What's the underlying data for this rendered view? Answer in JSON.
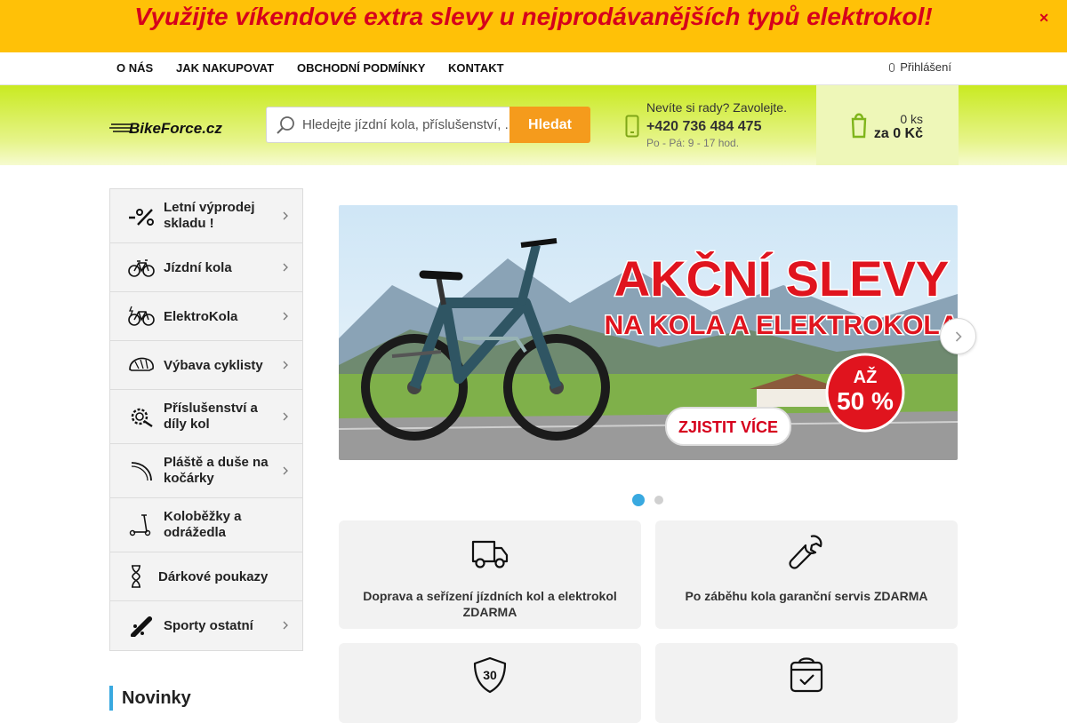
{
  "promo": {
    "text": "Využijte víkendové extra slevy u nejprodávanějších typů elektrokol!",
    "close_icon": "close-icon"
  },
  "topnav": {
    "items": [
      "O nás",
      "Jak nakupovat",
      "Obchodní podmínky",
      "Kontakt"
    ],
    "login_label": "Přihlášení"
  },
  "header": {
    "logo_text": "BikeForce.cz",
    "search_placeholder": "Hledejte jízdní kola, příslušenství, ...",
    "search_button": "Hledat",
    "help_title": "Nevíte si rady? Zavolejte.",
    "phone": "+420 736 484 475",
    "hours": "Po - Pá: 9 - 17 hod.",
    "cart_count": "0 ks",
    "cart_price": "za 0 Kč"
  },
  "sidebar": {
    "items": [
      {
        "label": "Letní výprodej skladu !",
        "icon": "percent-icon",
        "has_arrow": true
      },
      {
        "label": "Jízdní kola",
        "icon": "bicycle-icon",
        "has_arrow": true
      },
      {
        "label": "ElektroKola",
        "icon": "ebike-icon",
        "has_arrow": true
      },
      {
        "label": "Výbava cyklisty",
        "icon": "helmet-icon",
        "has_arrow": true
      },
      {
        "label": "Příslušenství a díly kol",
        "icon": "gear-icon",
        "has_arrow": true
      },
      {
        "label": "Pláště a duše na kočárky",
        "icon": "tire-icon",
        "has_arrow": true
      },
      {
        "label": "Koloběžky a odrážedla",
        "icon": "scooter-icon",
        "has_arrow": false
      },
      {
        "label": "Dárkové poukazy",
        "icon": "hourglass-icon",
        "has_arrow": false
      },
      {
        "label": "Sporty ostatní",
        "icon": "skateboard-icon",
        "has_arrow": true
      }
    ],
    "novinky": "Novinky"
  },
  "banner": {
    "line1": "AKČNÍ SLEVY",
    "line2": "NA KOLA A ELEKTROKOLA",
    "badge_top": "AŽ",
    "badge_value": "50 %",
    "cta": "ZJISTIT VÍCE",
    "slides_total": 2,
    "active_slide": 1
  },
  "features": [
    {
      "text": "Doprava a seřízení jízdních kol a elektrokol ZDARMA",
      "icon": "truck-icon"
    },
    {
      "text": "Po záběhu kola garanční servis ZDARMA",
      "icon": "wrench-icon"
    },
    {
      "text": "",
      "icon": "shield-30-icon",
      "badge": "30"
    },
    {
      "text": "",
      "icon": "calendar-check-icon"
    }
  ],
  "colors": {
    "promo_bg": "#ffc107",
    "promo_text": "#d6001c",
    "accent_green": "#c9ea21",
    "search_button": "#f59b1c",
    "dot_active": "#39a9e0",
    "banner_red": "#e0141e"
  }
}
